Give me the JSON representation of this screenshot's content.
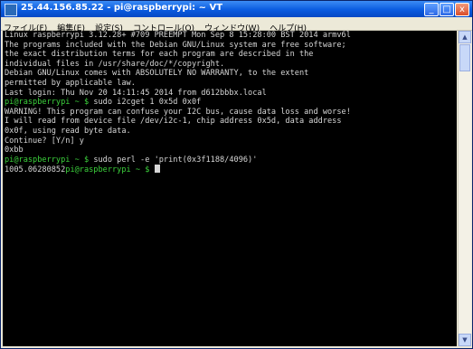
{
  "window": {
    "title": "25.44.156.85.22 - pi@raspberrypi: ~ VT",
    "controls": {
      "minimize": "_",
      "maximize": "□",
      "close": "x"
    }
  },
  "menubar": {
    "items": [
      "ファイル(F)",
      "編集(E)",
      "設定(S)",
      "コントロール(O)",
      "ウィンドウ(W)",
      "ヘルプ(H)"
    ]
  },
  "terminal": {
    "lines": [
      "Linux raspberrypi 3.12.28+ #709 PREEMPT Mon Sep 8 15:28:00 BST 2014 armv6l",
      "",
      "The programs included with the Debian GNU/Linux system are free software;",
      "the exact distribution terms for each program are described in the",
      "individual files in /usr/share/doc/*/copyright.",
      "",
      "Debian GNU/Linux comes with ABSOLUTELY NO WARRANTY, to the extent",
      "permitted by applicable law.",
      "Last login: Thu Nov 20 14:11:45 2014 from d612bbbx.local",
      "",
      "WARNING! This program can confuse your I2C bus, cause data loss and worse!",
      "I will read from device file /dev/i2c-1, chip address 0x5d, data address",
      "0x0f, using read byte data.",
      "Continue? [Y/n] y",
      "0xbb",
      "",
      ""
    ],
    "prompt": "pi@raspberrypi ~ $",
    "cmd_i2cget": " sudo i2cget 1 0x5d 0x0f",
    "cmd_perl": " sudo perl -e 'print(0x3f1188/4096)'",
    "perl_output": "1005.06280852",
    "final_prompt": "pi@raspberrypi ~ $"
  }
}
